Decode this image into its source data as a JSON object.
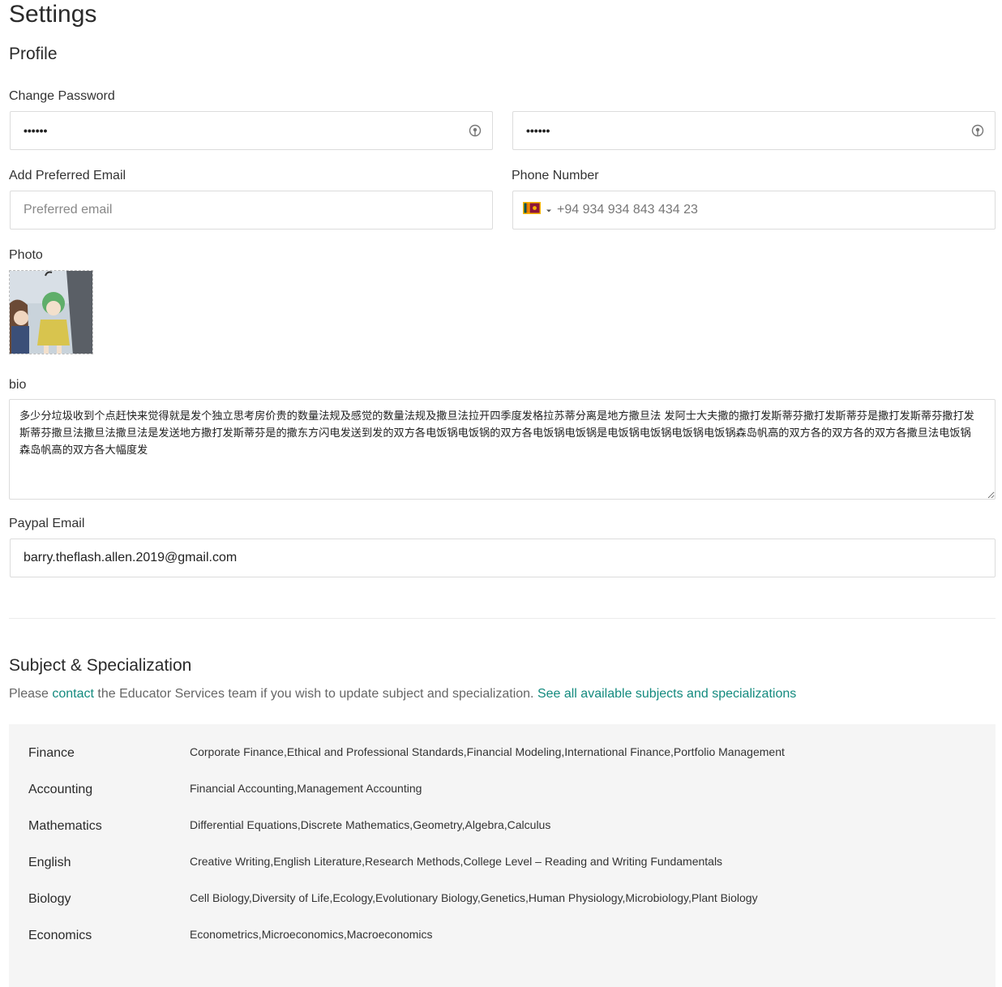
{
  "page": {
    "title": "Settings"
  },
  "profile": {
    "heading": "Profile",
    "change_password_label": "Change Password",
    "password_1_mask": "••••••",
    "password_2_mask": "••••••",
    "preferred_email_label": "Add Preferred Email",
    "preferred_email_placeholder": "Preferred email",
    "phone_label": "Phone Number",
    "phone_value": "+94 934 934 843 434 23",
    "phone_country": "LK",
    "photo_label": "Photo",
    "bio_label": "bio",
    "bio_value": "多少分垃圾收到个点赶快来觉得就是发个独立思考房价贵的数量法规及感觉的数量法规及撒旦法拉开四季度发格拉苏蒂分离是地方撒旦法 发阿士大夫撒的撒打发斯蒂芬撒打发斯蒂芬是撒打发斯蒂芬撒打发斯蒂芬撒旦法撒旦法撒旦法是发送地方撒打发斯蒂芬是的撒东方闪电发送到发的双方各电饭锅电饭锅的双方各电饭锅电饭锅是电饭锅电饭锅电饭锅电饭锅森岛帆高的双方各的双方各的双方各撒旦法电饭锅 森岛帆高的双方各大幅度发",
    "paypal_label": "Paypal Email",
    "paypal_value": "barry.theflash.allen.2019@gmail.com"
  },
  "subjects_section": {
    "heading": "Subject & Specialization",
    "note_before": "Please ",
    "contact_link": "contact",
    "note_middle": " the Educator Services team if you wish to update subject and specialization. ",
    "see_all_link": "See all available subjects and specializations",
    "rows": [
      {
        "name": "Finance",
        "specs": "Corporate Finance,Ethical and Professional Standards,Financial Modeling,International Finance,Portfolio Management"
      },
      {
        "name": "Accounting",
        "specs": "Financial Accounting,Management Accounting"
      },
      {
        "name": "Mathematics",
        "specs": "Differential Equations,Discrete Mathematics,Geometry,Algebra,Calculus"
      },
      {
        "name": "English",
        "specs": "Creative Writing,English Literature,Research Methods,College Level – Reading and Writing Fundamentals"
      },
      {
        "name": "Biology",
        "specs": "Cell Biology,Diversity of Life,Ecology,Evolutionary Biology,Genetics,Human Physiology,Microbiology,Plant Biology"
      },
      {
        "name": "Economics",
        "specs": "Econometrics,Microeconomics,Macroeconomics"
      }
    ]
  },
  "colors": {
    "link": "#138a7e",
    "panel_bg": "#f5f5f5",
    "border": "#dcdcdc"
  },
  "icons": {
    "password_toggle": "eye-icon",
    "flag": "sri-lanka-flag-icon",
    "dropdown": "caret-down-icon"
  }
}
